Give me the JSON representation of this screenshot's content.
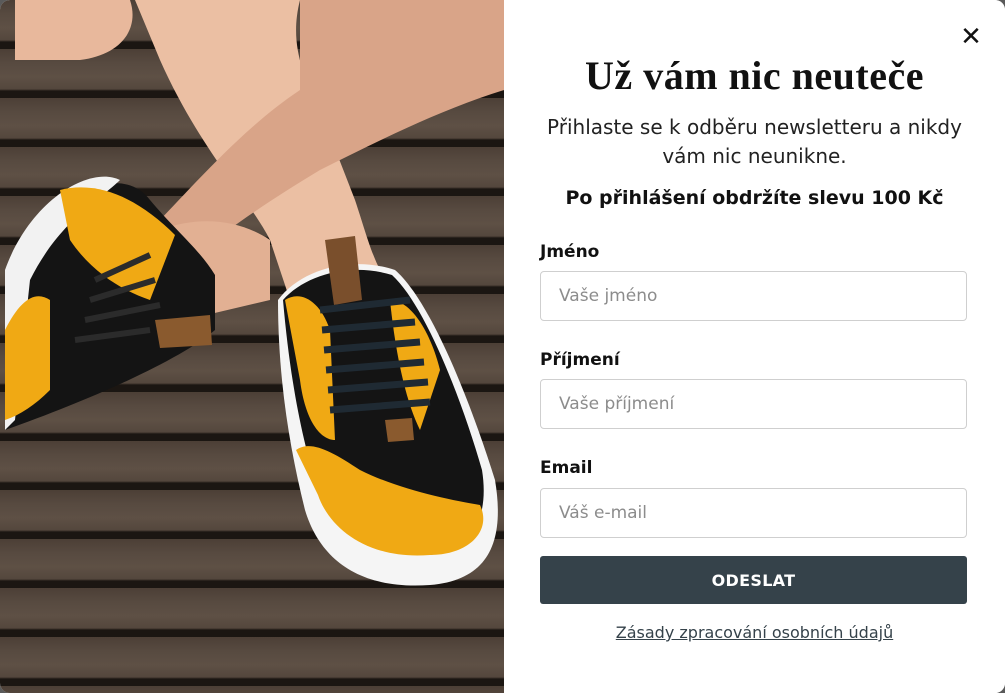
{
  "popup": {
    "image": {
      "description_icon": "sneakers-photo"
    },
    "close_icon": "close-icon",
    "close_symbol": "✕",
    "title": "Už vám nic neuteče",
    "subtitle": "Přihlaste se k odběru newsletteru a nikdy vám nic neunikne.",
    "discount_text": "Po přihlášení obdržíte slevu 100 Kč",
    "fields": {
      "first_name": {
        "label": "Jméno",
        "placeholder": "Vaše jméno",
        "value": ""
      },
      "last_name": {
        "label": "Příjmení",
        "placeholder": "Vaše příjmení",
        "value": ""
      },
      "email": {
        "label": "Email",
        "placeholder": "Váš e-mail",
        "value": ""
      }
    },
    "submit_label": "ODESLAT",
    "privacy_link": "Zásady zpracování osobních údajů"
  },
  "colors": {
    "button_bg": "#35424a",
    "link": "#35424a",
    "shoe_yellow": "#f0a914",
    "shoe_black": "#141414",
    "wood": "#574a40"
  }
}
